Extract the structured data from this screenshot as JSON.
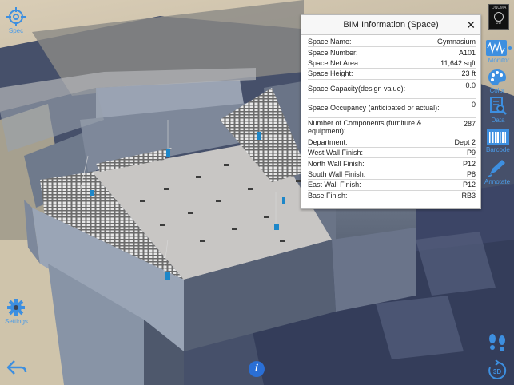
{
  "toolbar_left": {
    "top_button_label": "Spec",
    "settings_label": "Settings"
  },
  "toolbar_right": {
    "logo_top": "ONUMA",
    "logo_bottom": "3D",
    "monitor_label": "Monitor",
    "color_label": "Color",
    "data_label": "Data",
    "barcode_label": "Barcode",
    "annotate_label": "Annotate",
    "view_3d_label": "3D"
  },
  "bim_panel": {
    "title": "BIM Information (Space)",
    "close_glyph": "✕",
    "rows": [
      {
        "key": "Space Name:",
        "value": "Gymnasium"
      },
      {
        "key": "Space Number:",
        "value": "A101"
      },
      {
        "key": "Space Net Area:",
        "value": "11,642 sqft"
      },
      {
        "key": "Space Height:",
        "value": "23 ft"
      },
      {
        "key": "Space Capacity(design value):",
        "value": "0.0"
      },
      {
        "key": "Space Occupancy (anticipated or actual):",
        "value": "0"
      },
      {
        "key": "Number of Components (furniture & equipment):",
        "value": "287"
      },
      {
        "key": "Department:",
        "value": "Dept 2"
      },
      {
        "key": "West Wall Finish:",
        "value": "P9"
      },
      {
        "key": "North Wall Finish:",
        "value": "P12"
      },
      {
        "key": "South Wall Finish:",
        "value": "P8"
      },
      {
        "key": "East Wall Finish:",
        "value": "P12"
      },
      {
        "key": "Base Finish:",
        "value": "RB3"
      }
    ]
  },
  "info_button": "i",
  "colors": {
    "accent": "#3d8fe0",
    "panel_bg": "#ffffff",
    "floor": "#cfcfcf",
    "wall": "#8a96a8",
    "ground": "#d8ccb5"
  },
  "icons": {
    "top_left": "crosshair-target-icon",
    "settings": "gear-icon",
    "back": "back-arrow-icon",
    "monitor": "waveform-icon",
    "color": "palette-icon",
    "data": "document-search-icon",
    "barcode": "barcode-icon",
    "annotate": "pen-icon",
    "walk": "footprints-icon",
    "rotate": "rotate-3d-icon"
  }
}
